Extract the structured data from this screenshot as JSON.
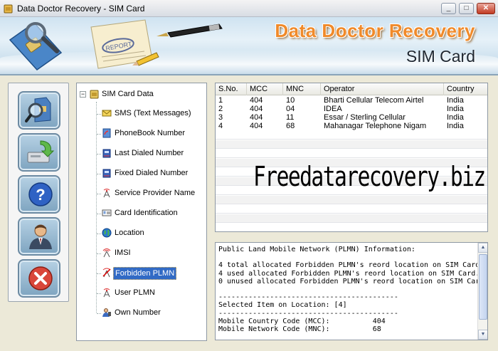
{
  "window": {
    "title": "Data Doctor Recovery - SIM Card",
    "buttons": {
      "minimize": "_",
      "maximize": "□",
      "close": "✕"
    }
  },
  "banner": {
    "brand": "Data Doctor Recovery",
    "product": "SIM Card"
  },
  "toolbar": {
    "buttons": [
      {
        "name": "sim-search-icon"
      },
      {
        "name": "save-drive-icon"
      },
      {
        "name": "help-icon"
      },
      {
        "name": "user-support-icon"
      },
      {
        "name": "exit-icon"
      }
    ]
  },
  "tree": {
    "root": "SIM Card Data",
    "items": [
      {
        "label": "SMS (Text Messages)",
        "icon": "envelope-icon"
      },
      {
        "label": "PhoneBook Number",
        "icon": "phonebook-icon"
      },
      {
        "label": "Last Dialed Number",
        "icon": "phone-icon"
      },
      {
        "label": "Fixed Dialed Number",
        "icon": "phone-icon"
      },
      {
        "label": "Service Provider Name",
        "icon": "antenna-icon"
      },
      {
        "label": "Card Identification",
        "icon": "id-card-icon"
      },
      {
        "label": "Location",
        "icon": "globe-icon"
      },
      {
        "label": "IMSI",
        "icon": "signal-icon"
      },
      {
        "label": "Forbidden PLMN",
        "icon": "forbidden-antenna-icon",
        "selected": true
      },
      {
        "label": "User PLMN",
        "icon": "antenna-icon"
      },
      {
        "label": "Own Number",
        "icon": "person-icon"
      }
    ]
  },
  "table": {
    "columns": [
      "S.No.",
      "MCC",
      "MNC",
      "Operator",
      "Country"
    ],
    "rows": [
      [
        "1",
        "404",
        "10",
        "Bharti Cellular Telecom Airtel",
        "India"
      ],
      [
        "2",
        "404",
        "04",
        "IDEA",
        "India"
      ],
      [
        "3",
        "404",
        "11",
        "Essar / Sterling Cellular",
        "India"
      ],
      [
        "4",
        "404",
        "68",
        "Mahanagar Telephone Nigam",
        "India"
      ]
    ]
  },
  "watermark": "Freedatarecovery.biz",
  "info": {
    "text": "Public Land Mobile Network (PLMN) Information:\n\n4 total allocated Forbidden PLMN's reord location on SIM Card.\n4 used allocated Forbidden PLMN's reord location on SIM Card.\n0 unused allocated Forbidden PLMN's reord location on SIM Card.\n\n------------------------------------------\nSelected Item on Location: [4]\n------------------------------------------\nMobile Country Code (MCC):          404\nMobile Network Code (MNC):          68"
  }
}
